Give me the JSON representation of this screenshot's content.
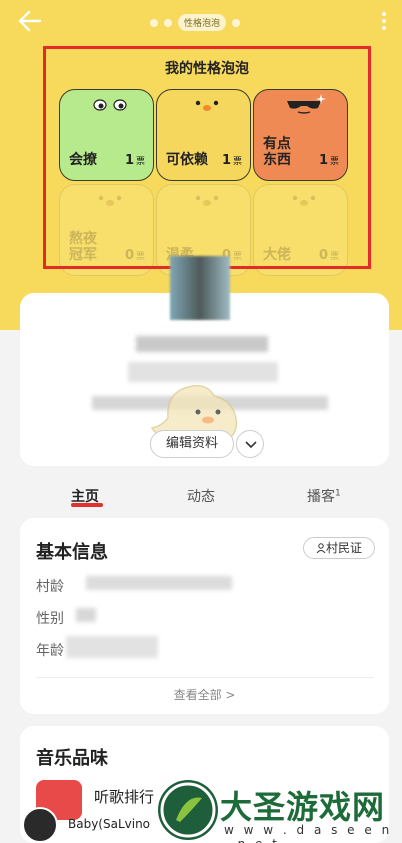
{
  "header": {
    "indicator_label": "性格泡泡",
    "colors": {
      "background": "#f7d95b",
      "highlight": "#e52a2a"
    }
  },
  "bubbles": {
    "title": "我的性格泡泡",
    "vote_unit": "票",
    "tiles": [
      {
        "label": "会撩",
        "count": "1",
        "color": "#b7ea8c"
      },
      {
        "label": "可依赖",
        "count": "1",
        "color": "#f5d75d"
      },
      {
        "label": "有点东西",
        "count": "1",
        "color": "#f08a55"
      },
      {
        "label": "熬夜冠军",
        "count": "0",
        "color": "#f7d95b"
      },
      {
        "label": "温柔",
        "count": "0",
        "color": "#f7d95b"
      },
      {
        "label": "大佬",
        "count": "0",
        "color": "#f7d95b"
      }
    ]
  },
  "profile": {
    "edit_label": "编辑资料"
  },
  "tabs": [
    {
      "label": "主页",
      "badge": ""
    },
    {
      "label": "动态",
      "badge": ""
    },
    {
      "label": "播客",
      "badge": "1"
    }
  ],
  "basic_info": {
    "title": "基本信息",
    "cert_label": "村民证",
    "rows": [
      "村龄",
      "性别",
      "年龄"
    ],
    "view_all": "查看全部 >"
  },
  "music": {
    "title": "音乐品味",
    "item": "听歌排行"
  },
  "player": {
    "name": "Baby(SaLvino"
  },
  "watermark": {
    "title": "大圣游戏网",
    "url": "w w w . d a s e e n . n e t"
  }
}
